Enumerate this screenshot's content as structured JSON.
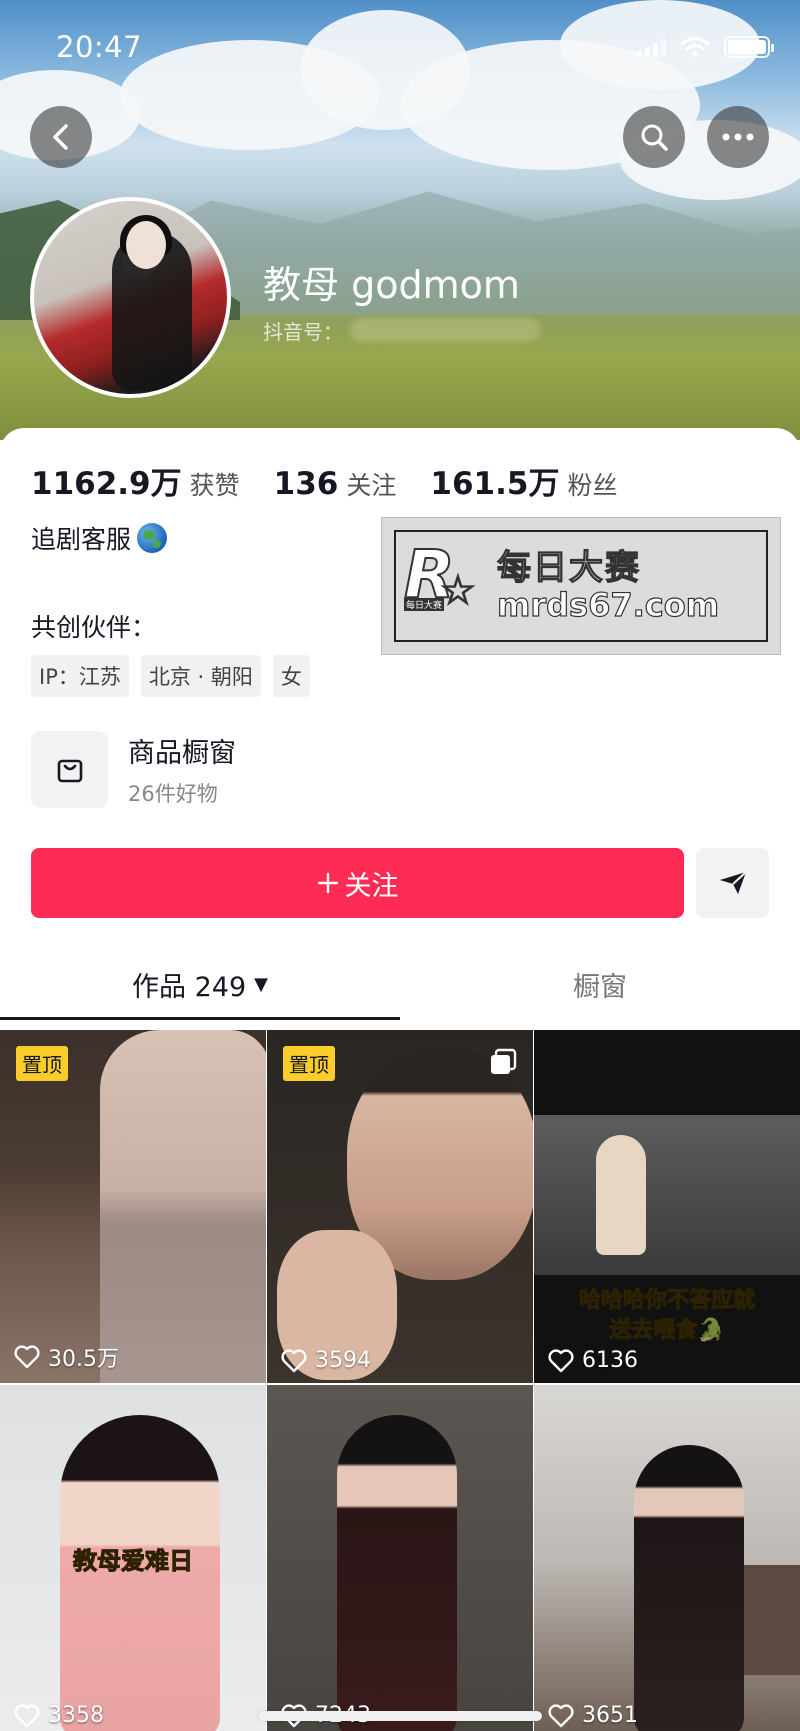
{
  "status_bar": {
    "time": "20:47",
    "battery_level": 1.0
  },
  "header": {
    "nickname": "教母 godmom",
    "douyin_id_label": "抖音号："
  },
  "stats": [
    {
      "value": "1162.9万",
      "label": "获赞"
    },
    {
      "value": "136",
      "label": "关注"
    },
    {
      "value": "161.5万",
      "label": "粉丝"
    }
  ],
  "bio": {
    "text": "追剧客服",
    "emoji": "globe-emoji"
  },
  "cocreate_label": "共创伙伴：",
  "tags": [
    "IP：江苏",
    "北京 · 朝阳",
    "女"
  ],
  "watermark": {
    "badge": "每日大赛",
    "line1": "每日大赛",
    "line2": "mrds67.com"
  },
  "shop": {
    "title": "商品橱窗",
    "subtitle": "26件好物"
  },
  "follow_button": {
    "label": "关注",
    "icon": "plus-icon"
  },
  "tabs": [
    {
      "label": "作品 249",
      "active": true
    },
    {
      "label": "橱窗",
      "active": false
    }
  ],
  "videos": [
    {
      "pinned": true,
      "pin_label": "置顶",
      "likes": "30.5万",
      "caption": ""
    },
    {
      "pinned": true,
      "pin_label": "置顶",
      "likes": "3594",
      "caption": "",
      "multi": true
    },
    {
      "pinned": false,
      "likes": "6136",
      "caption": "哈哈哈你不答应就\n送去喂食🐊"
    },
    {
      "pinned": false,
      "likes": "3358",
      "caption": "教母爱难日"
    },
    {
      "pinned": false,
      "likes": "7243",
      "caption": ""
    },
    {
      "pinned": false,
      "likes": "3651",
      "caption": ""
    }
  ],
  "colors": {
    "accent": "#fe2c55",
    "pin": "#facd2b"
  }
}
